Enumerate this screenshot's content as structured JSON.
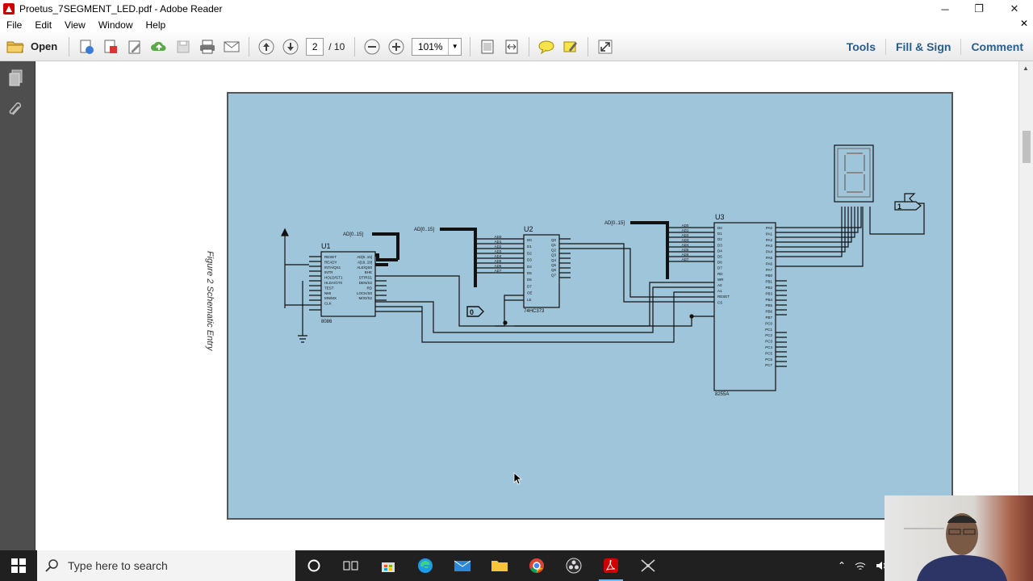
{
  "window": {
    "title": "Proetus_7SEGMENT_LED.pdf - Adobe Reader",
    "controls": [
      "─",
      "❐",
      "✕"
    ]
  },
  "menu": [
    "File",
    "Edit",
    "View",
    "Window",
    "Help"
  ],
  "toolbar": {
    "open_label": "Open",
    "page_current": "2",
    "page_total": "/ 10",
    "zoom": "101%",
    "tools_label": "Tools",
    "fill_sign_label": "Fill & Sign",
    "comment_label": "Comment"
  },
  "figure": {
    "caption": "Figure 2 Schematic Entry",
    "u1_label": "U1",
    "u1_part": "8086",
    "u1_pins_left": [
      "RESET",
      "READY",
      "INTA/QS1",
      "INTR",
      "HOLD/GT1",
      "HLDA/GT0",
      "TEST",
      "NMI",
      "MN/MX",
      "CLK"
    ],
    "u1_pins_right": [
      "AD[0..15]",
      "A[16..19]",
      "ALE/QS0",
      "BHE",
      "DT/RS1",
      "DEN/S2",
      "RD",
      "LOCK/S0",
      "M/IO/S2"
    ],
    "u2_label": "U2",
    "u2_part": "74HC373",
    "u2_pins_left": [
      "D0",
      "D1",
      "D2",
      "D3",
      "D4",
      "D5",
      "D6",
      "D7",
      "OE",
      "LE"
    ],
    "u2_pins_right": [
      "Q0",
      "Q1",
      "Q2",
      "Q3",
      "Q4",
      "Q5",
      "Q6",
      "Q7"
    ],
    "u3_label": "U3",
    "u3_part": "8255A",
    "u3_pins_left": [
      "D0",
      "D1",
      "D2",
      "D3",
      "D4",
      "D5",
      "D6",
      "D7",
      "RD",
      "WR",
      "A0",
      "A1",
      "RESET",
      "CS"
    ],
    "u3_pins_right": [
      "PA0",
      "PA1",
      "PA2",
      "PA3",
      "PA4",
      "PA5",
      "PA6",
      "PA7",
      "PB0",
      "PB1",
      "PB2",
      "PB3",
      "PB4",
      "PB5",
      "PB6",
      "PB7",
      "PC0",
      "PC1",
      "PC2",
      "PC3",
      "PC4",
      "PC5",
      "PC6",
      "PC7"
    ],
    "bus_u1": "AD[0..15]",
    "bus_u2": "AD[0..15]",
    "bus_u3": "AD[0..15]",
    "logic_zero": "0",
    "logic_one": "1",
    "u2_ad_lines": [
      "AD0",
      "AD1",
      "AD2",
      "AD3",
      "AD4",
      "AD5",
      "AD6",
      "AD7"
    ],
    "u3_ad_lines": [
      "AD0",
      "AD1",
      "AD2",
      "AD3",
      "AD4",
      "AD5",
      "AD6",
      "AD7"
    ]
  },
  "taskbar": {
    "search_placeholder": "Type here to search"
  },
  "colors": {
    "figure_bg": "#9fc5db",
    "left_panel": "#4e4e4e",
    "taskbar": "#202020",
    "link": "#2a5d8e"
  }
}
